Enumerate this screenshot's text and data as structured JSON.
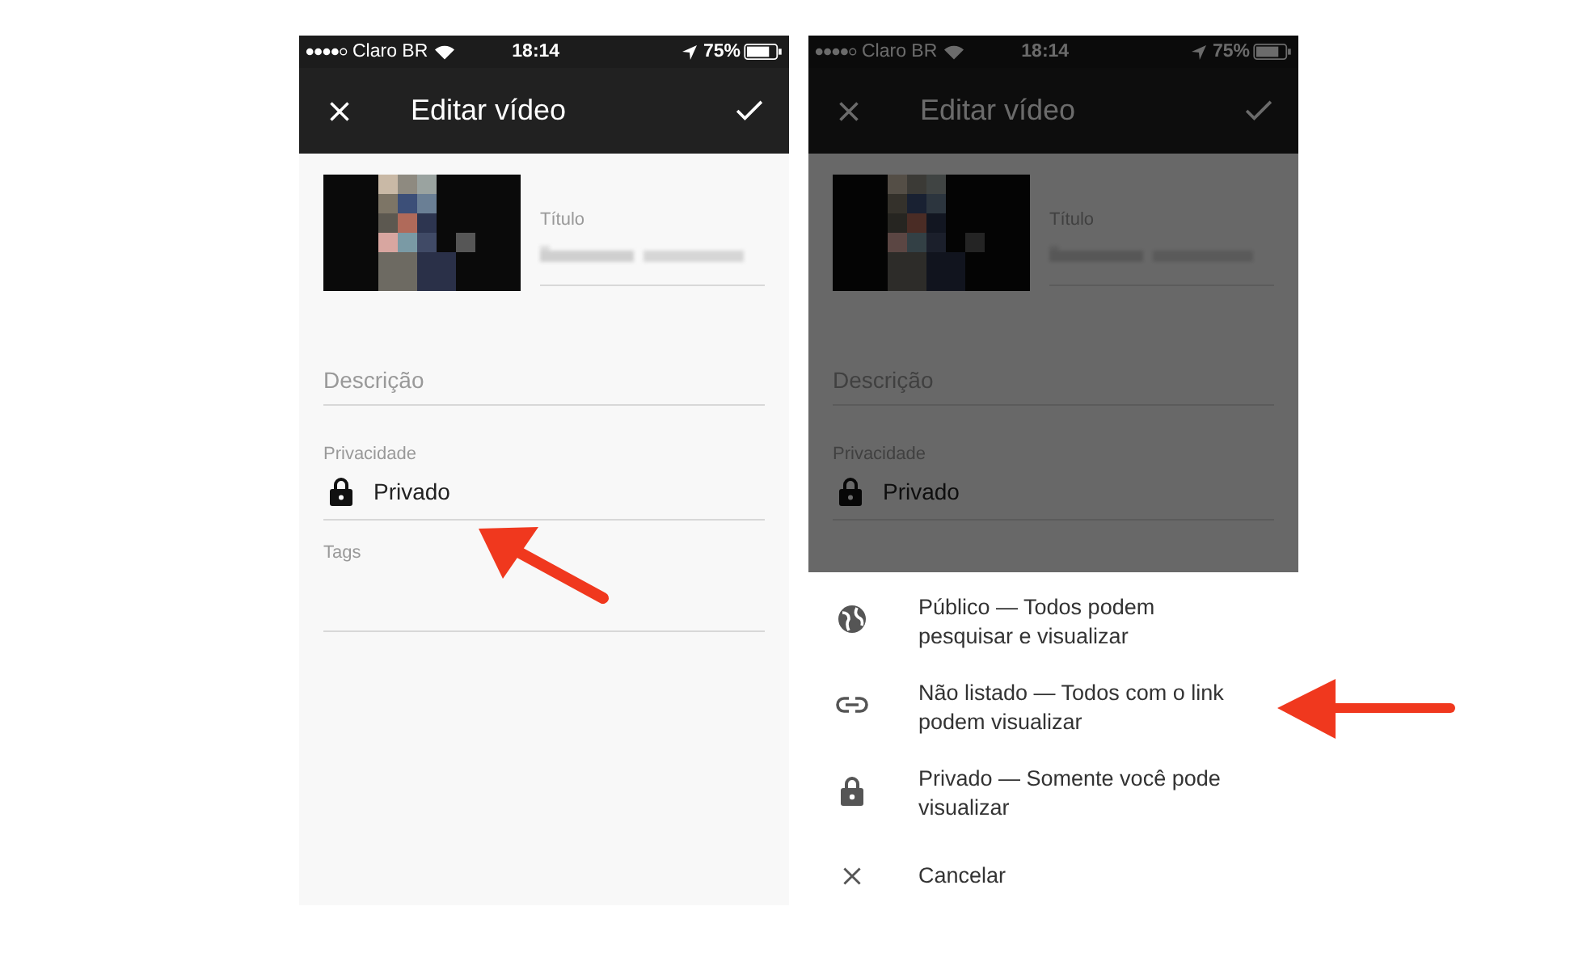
{
  "screens": [
    {
      "status_bar": {
        "carrier": "Claro BR",
        "time": "18:14",
        "battery": "75%"
      },
      "toolbar_title": "Editar vídeo",
      "fields": [
        {
          "kind": "title",
          "label": "Título"
        },
        {
          "kind": "text",
          "placeholder": "Descrição"
        },
        {
          "kind": "privacy",
          "label": "Privacidade",
          "value": "Privado"
        },
        {
          "kind": "tags",
          "label": "Tags"
        }
      ],
      "dimmed": false
    },
    {
      "status_bar": {
        "carrier": "Claro BR",
        "time": "18:14",
        "battery": "75%"
      },
      "toolbar_title": "Editar vídeo",
      "fields": [
        {
          "kind": "title",
          "label": "Título"
        },
        {
          "kind": "text",
          "placeholder": "Descrição"
        },
        {
          "kind": "privacy",
          "label": "Privacidade",
          "value": "Privado"
        }
      ],
      "dimmed": true,
      "sheet": {
        "options": [
          {
            "kind": "public",
            "text": "Público — Todos podem pesquisar e visualizar"
          },
          {
            "kind": "unlisted",
            "text": "Não listado — Todos com o link podem visualizar"
          },
          {
            "kind": "private",
            "text": "Privado — Somente você pode visualizar"
          },
          {
            "kind": "cancel",
            "text": "Cancelar"
          }
        ]
      }
    }
  ]
}
